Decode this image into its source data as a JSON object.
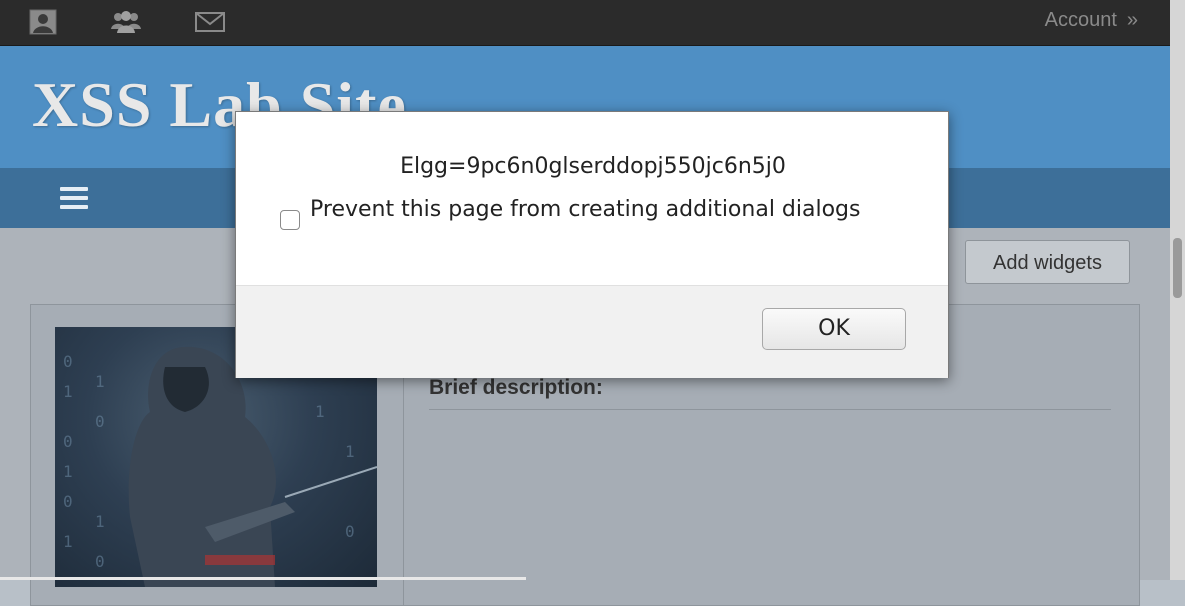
{
  "topbar": {
    "icons": [
      "user-icon",
      "users-icon",
      "mail-icon"
    ],
    "account_label": "Account",
    "account_chevron": "»"
  },
  "header": {
    "site_title": "XSS Lab Site"
  },
  "nav": {
    "menu_icon": "hamburger-icon"
  },
  "content": {
    "add_widgets_label": "Add widgets",
    "brief_description_label": "Brief description:"
  },
  "dialog": {
    "message": "Elgg=9pc6n0glserddopj550jc6n5j0",
    "checkbox_label": "Prevent this page from creating additional dialogs",
    "checkbox_checked": false,
    "ok_label": "OK"
  },
  "colors": {
    "topbar": "#2b2b2b",
    "header": "#4f8fc4",
    "navbar": "#3d6f99",
    "dialog_bg": "#ffffff",
    "dialog_footer": "#f1f1f1"
  }
}
